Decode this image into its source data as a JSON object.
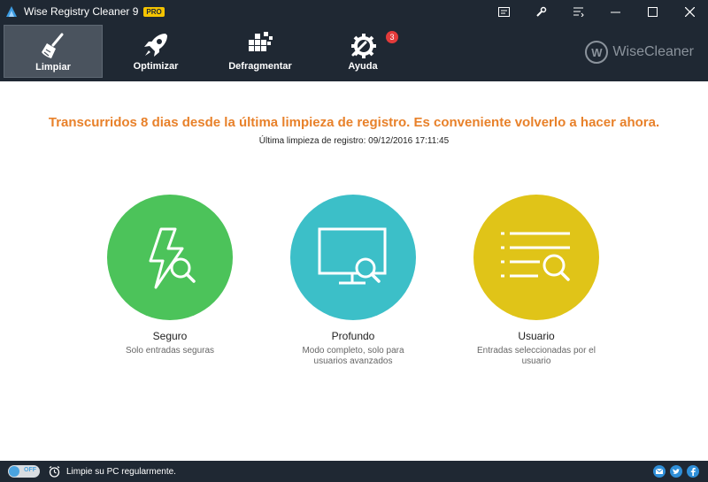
{
  "window": {
    "title": "Wise Registry Cleaner 9",
    "badge": "PRO",
    "controls": [
      "menu-icon",
      "tools-icon",
      "skin-icon",
      "minimize-icon",
      "maximize-icon",
      "close-icon"
    ]
  },
  "toolbar": {
    "items": [
      {
        "label": "Limpiar",
        "icon": "broom-icon",
        "active": true
      },
      {
        "label": "Optimizar",
        "icon": "rocket-icon",
        "active": false
      },
      {
        "label": "Defragmentar",
        "icon": "defrag-icon",
        "active": false
      },
      {
        "label": "Ayuda",
        "icon": "wrench-gear-icon",
        "active": false,
        "badge": "3"
      }
    ],
    "brand": {
      "letter": "W",
      "name": "WiseCleaner"
    }
  },
  "main": {
    "headline": "Transcurridos 8 dias desde la última limpieza de registro. Es conveniente volverlo a hacer ahora.",
    "last_clean": "Última limpieza de registro: 09/12/2016 17:11:45",
    "modes": [
      {
        "title": "Seguro",
        "desc": "Solo entradas seguras",
        "color": "#4cc35a",
        "icon": "lightning-search-icon"
      },
      {
        "title": "Profundo",
        "desc": "Modo completo, solo para usuarios avanzados",
        "color": "#3cbfc8",
        "icon": "monitor-search-icon"
      },
      {
        "title": "Usuario",
        "desc": "Entradas seleccionadas por el usuario",
        "color": "#e0c418",
        "icon": "list-search-icon"
      }
    ]
  },
  "statusbar": {
    "toggle": "OFF",
    "text": "Limpie su PC regularmente.",
    "social": [
      "email-icon",
      "twitter-icon",
      "facebook-icon"
    ]
  },
  "colors": {
    "dark": "#1f2833",
    "accent_orange": "#e8812a",
    "active_tab": "#4a535e"
  }
}
